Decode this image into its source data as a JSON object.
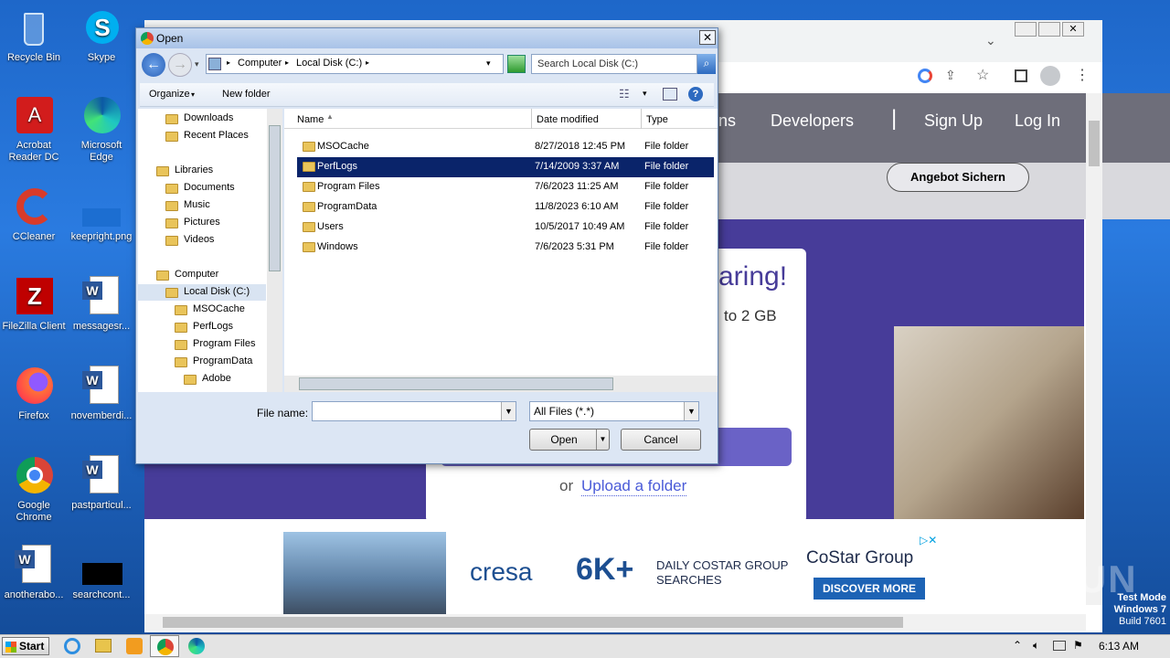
{
  "desktop": {
    "icons": [
      {
        "label": "Recycle Bin"
      },
      {
        "label": "Skype"
      },
      {
        "label": "Acrobat Reader DC"
      },
      {
        "label": "Microsoft Edge"
      },
      {
        "label": "CCleaner"
      },
      {
        "label": "keepright.png"
      },
      {
        "label": "FileZilla Client"
      },
      {
        "label": "messagesr..."
      },
      {
        "label": "Firefox"
      },
      {
        "label": "novemberdi..."
      },
      {
        "label": "Google Chrome"
      },
      {
        "label": "pastparticul..."
      },
      {
        "label": "anotherabo..."
      },
      {
        "label": "searchcont..."
      }
    ]
  },
  "browser": {
    "nav_links": [
      "ns",
      "Developers",
      "Sign Up",
      "Log In"
    ],
    "cta_button": "Angebot Sichern",
    "card_heading": "aring!",
    "card_sub": "to 2 GB",
    "or_label": "or",
    "upload_folder": "Upload a folder",
    "ad": {
      "brand": "cresa",
      "stat": "6K+",
      "stat_desc_1": "DAILY COSTAR GROUP",
      "stat_desc_2": "SEARCHES",
      "partner": "CoStar Group",
      "discover": "DISCOVER MORE"
    }
  },
  "dialog": {
    "title": "Open",
    "breadcrumb": [
      "Computer",
      "Local Disk (C:)"
    ],
    "search_placeholder": "Search Local Disk (C:)",
    "toolbar": {
      "organize": "Organize",
      "new_folder": "New folder"
    },
    "nav_items": [
      {
        "label": "Downloads",
        "indent": 1
      },
      {
        "label": "Recent Places",
        "indent": 1
      },
      {
        "label": "Libraries",
        "indent": 0
      },
      {
        "label": "Documents",
        "indent": 1
      },
      {
        "label": "Music",
        "indent": 1
      },
      {
        "label": "Pictures",
        "indent": 1
      },
      {
        "label": "Videos",
        "indent": 1
      },
      {
        "label": "Computer",
        "indent": 0
      },
      {
        "label": "Local Disk (C:)",
        "indent": 1
      },
      {
        "label": "MSOCache",
        "indent": 2
      },
      {
        "label": "PerfLogs",
        "indent": 2
      },
      {
        "label": "Program Files",
        "indent": 2
      },
      {
        "label": "ProgramData",
        "indent": 2
      },
      {
        "label": "Adobe",
        "indent": 3
      }
    ],
    "columns": {
      "name": "Name",
      "date": "Date modified",
      "type": "Type"
    },
    "files": [
      {
        "name": "MSOCache",
        "date": "8/27/2018 12:45 PM",
        "type": "File folder"
      },
      {
        "name": "PerfLogs",
        "date": "7/14/2009 3:37 AM",
        "type": "File folder"
      },
      {
        "name": "Program Files",
        "date": "7/6/2023 11:25 AM",
        "type": "File folder"
      },
      {
        "name": "ProgramData",
        "date": "11/8/2023 6:10 AM",
        "type": "File folder"
      },
      {
        "name": "Users",
        "date": "10/5/2017 10:49 AM",
        "type": "File folder"
      },
      {
        "name": "Windows",
        "date": "7/6/2023 5:31 PM",
        "type": "File folder"
      }
    ],
    "file_name_label": "File name:",
    "file_name_value": "",
    "filter": "All Files (*.*)",
    "open_button": "Open",
    "cancel_button": "Cancel"
  },
  "taskbar": {
    "start": "Start",
    "clock": "6:13 AM"
  },
  "watermark": {
    "line1": "Test Mode",
    "line2": "Windows 7",
    "line3": "Build 7601",
    "brand": "ANY RUN"
  }
}
